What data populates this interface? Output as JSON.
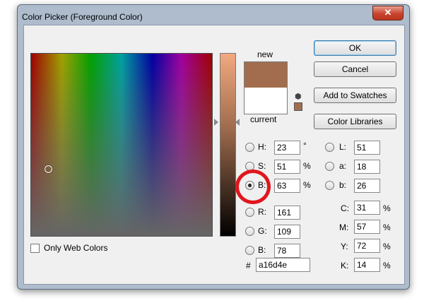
{
  "window": {
    "title": "Color Picker (Foreground Color)",
    "close_glyph": "✕"
  },
  "swatches": {
    "new_label": "new",
    "current_label": "current",
    "new_color": "#a16d4e",
    "current_color": "#ffffff"
  },
  "buttons": {
    "ok": "OK",
    "cancel": "Cancel",
    "add_swatches": "Add to Swatches",
    "libraries": "Color Libraries"
  },
  "hsb": {
    "h": {
      "label": "H:",
      "value": "23",
      "unit": "°"
    },
    "s": {
      "label": "S:",
      "value": "51",
      "unit": "%"
    },
    "b": {
      "label": "B:",
      "value": "63",
      "unit": "%"
    }
  },
  "rgb": {
    "r": {
      "label": "R:",
      "value": "161"
    },
    "g": {
      "label": "G:",
      "value": "109"
    },
    "b": {
      "label": "B:",
      "value": "78"
    }
  },
  "lab": {
    "l": {
      "label": "L:",
      "value": "51"
    },
    "a": {
      "label": "a:",
      "value": "18"
    },
    "b": {
      "label": "b:",
      "value": "26"
    }
  },
  "cmyk": {
    "c": {
      "label": "C:",
      "value": "31",
      "unit": "%"
    },
    "m": {
      "label": "M:",
      "value": "57",
      "unit": "%"
    },
    "y": {
      "label": "Y:",
      "value": "72",
      "unit": "%"
    },
    "k": {
      "label": "K:",
      "value": "14",
      "unit": "%"
    }
  },
  "hex": {
    "label": "#",
    "value": "a16d4e"
  },
  "web_colors": {
    "label": "Only Web Colors"
  },
  "colors": {
    "highlight_ring": "#e0161e",
    "selected_color": "#a16d4e"
  }
}
